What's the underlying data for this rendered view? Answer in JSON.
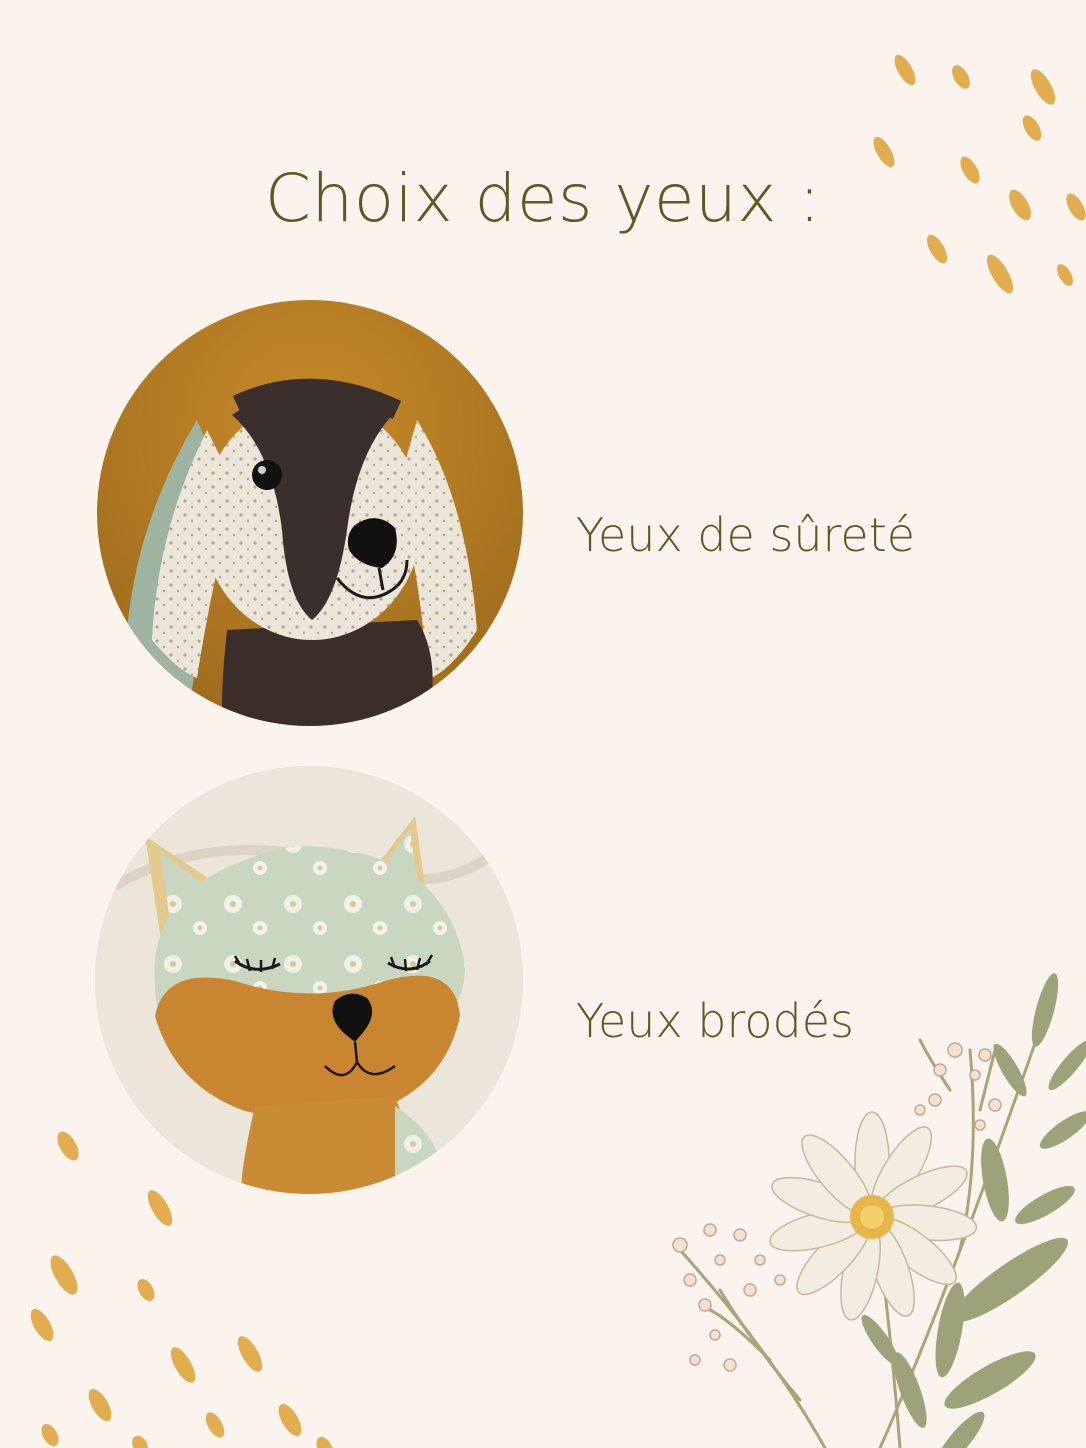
{
  "page": {
    "title": "Choix des yeux :"
  },
  "options": [
    {
      "label": "Yeux de sûreté",
      "image": "bunny-plush-with-safety-eyes"
    },
    {
      "label": "Yeux brodés",
      "image": "fox-plush-with-embroidered-eyes"
    }
  ],
  "colors": {
    "background": "#faf3ee",
    "text": "#5c5a22",
    "accent_dots": "#e2ad4f",
    "leaf_green": "#9ca37a"
  }
}
